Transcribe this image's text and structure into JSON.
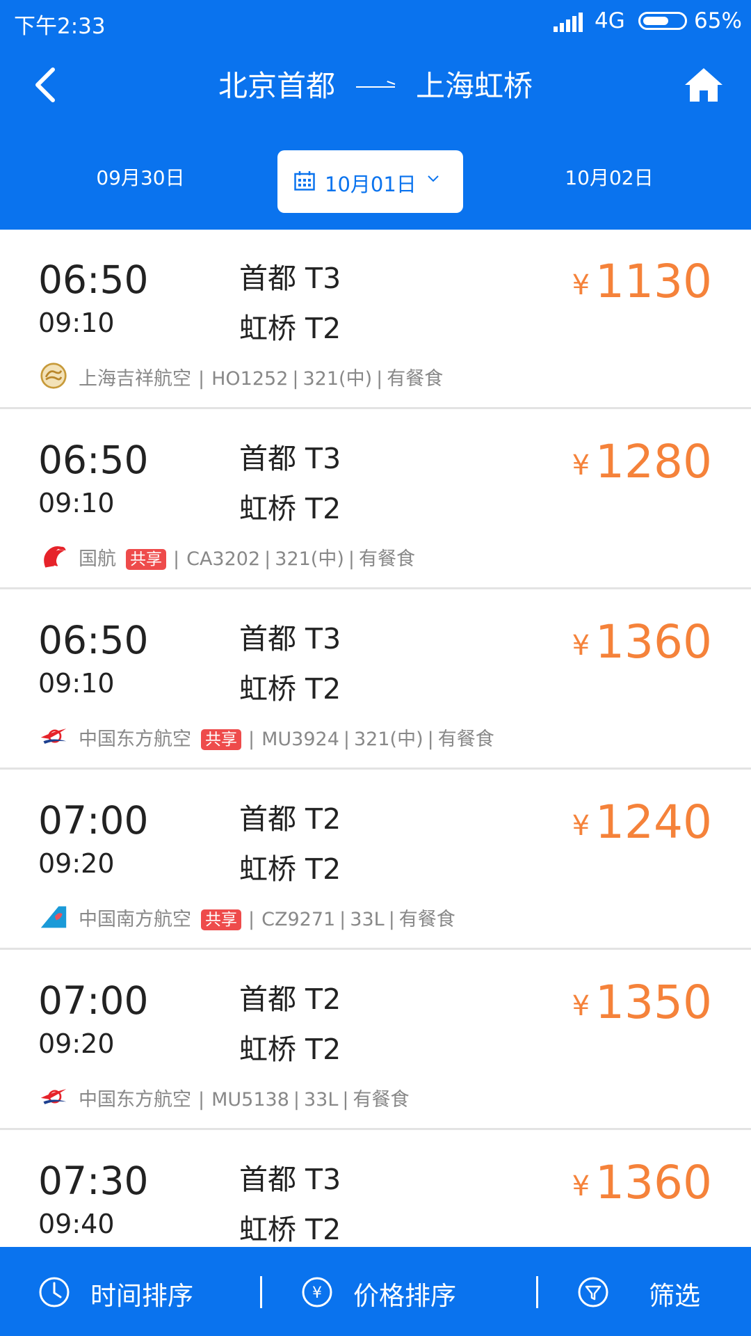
{
  "status": {
    "time": "下午2:33",
    "network": "4G",
    "battery": "65%",
    "battery_level": 0.65
  },
  "nav": {
    "from": "北京首都",
    "to": "上海虹桥"
  },
  "dates": {
    "prev": "09月30日",
    "current": "10月01日",
    "next": "10月02日"
  },
  "flights": [
    {
      "dep_time": "06:50",
      "arr_time": "09:10",
      "dep_airport": "首都 T3",
      "arr_airport": "虹桥 T2",
      "yen": "¥",
      "price": "1130",
      "airline": "上海吉祥航空",
      "logo": "juneyao-logo-icon",
      "shared": false,
      "shared_label": "",
      "flight_no": "HO1252",
      "aircraft": "321(中)",
      "meal": "有餐食"
    },
    {
      "dep_time": "06:50",
      "arr_time": "09:10",
      "dep_airport": "首都 T3",
      "arr_airport": "虹桥 T2",
      "yen": "¥",
      "price": "1280",
      "airline": "国航",
      "logo": "air-china-logo-icon",
      "shared": true,
      "shared_label": "共享",
      "flight_no": "CA3202",
      "aircraft": "321(中)",
      "meal": "有餐食"
    },
    {
      "dep_time": "06:50",
      "arr_time": "09:10",
      "dep_airport": "首都 T3",
      "arr_airport": "虹桥 T2",
      "yen": "¥",
      "price": "1360",
      "airline": "中国东方航空",
      "logo": "china-eastern-logo-icon",
      "shared": true,
      "shared_label": "共享",
      "flight_no": "MU3924",
      "aircraft": "321(中)",
      "meal": "有餐食"
    },
    {
      "dep_time": "07:00",
      "arr_time": "09:20",
      "dep_airport": "首都 T2",
      "arr_airport": "虹桥 T2",
      "yen": "¥",
      "price": "1240",
      "airline": "中国南方航空",
      "logo": "china-southern-logo-icon",
      "shared": true,
      "shared_label": "共享",
      "flight_no": "CZ9271",
      "aircraft": "33L",
      "meal": "有餐食"
    },
    {
      "dep_time": "07:00",
      "arr_time": "09:20",
      "dep_airport": "首都 T2",
      "arr_airport": "虹桥 T2",
      "yen": "¥",
      "price": "1350",
      "airline": "中国东方航空",
      "logo": "china-eastern-logo-icon",
      "shared": false,
      "shared_label": "",
      "flight_no": "MU5138",
      "aircraft": "33L",
      "meal": "有餐食"
    },
    {
      "dep_time": "07:30",
      "arr_time": "09:40",
      "dep_airport": "首都 T3",
      "arr_airport": "虹桥 T2",
      "yen": "¥",
      "price": "1360",
      "airline": "",
      "logo": "",
      "shared": false,
      "shared_label": "",
      "flight_no": "",
      "aircraft": "",
      "meal": ""
    }
  ],
  "bottom": {
    "time_sort": "时间排序",
    "price_sort": "价格排序",
    "filter": "筛选"
  },
  "colors": {
    "primary": "#0a73ee",
    "price": "#f5823a",
    "share_badge": "#ee4b4b"
  }
}
